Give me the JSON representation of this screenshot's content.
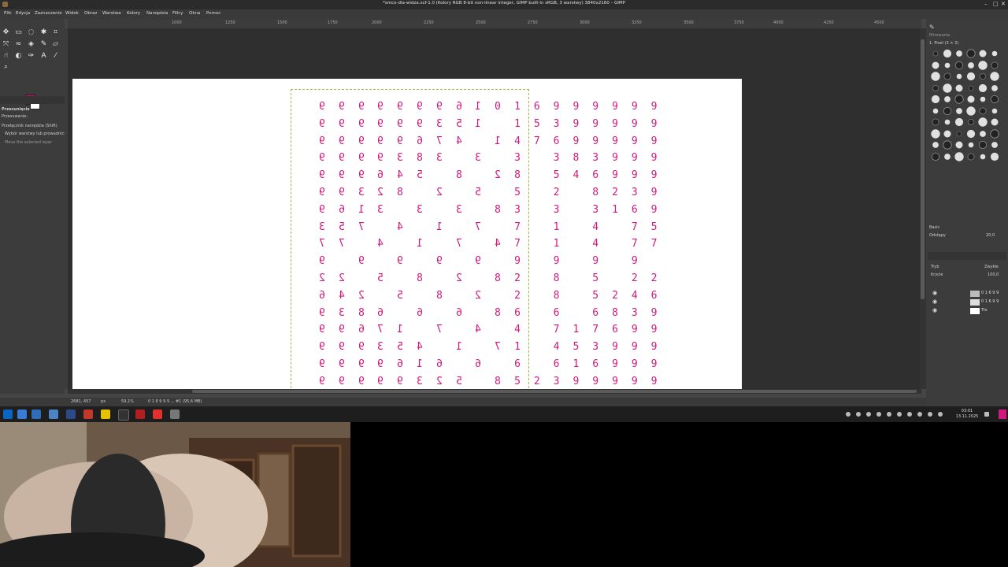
{
  "window": {
    "title": "*smco-dla-widza.xcf-1.0 (Kolory RGB 8-bit non-linear integer, GIMP built-in sRGB, 3 warstwy) 3840x2160 – GIMP",
    "controls": [
      "–",
      "□",
      "✕"
    ]
  },
  "menubar": {
    "items": [
      "Plik",
      "Edycja",
      "Zaznaczenie",
      "Widok",
      "Obraz",
      "Warstwa",
      "Kolory",
      "Narzędzia",
      "Filtry",
      "Okna",
      "Pomoc"
    ]
  },
  "ruler": {
    "ticks": [
      "1000",
      "1250",
      "1500",
      "1750",
      "2000",
      "2250",
      "2500",
      "2750",
      "3000",
      "3250",
      "3500",
      "3750",
      "4000",
      "4250",
      "4500"
    ]
  },
  "toolbox": {
    "tool_icons": [
      "move-tool-icon",
      "rect-select-icon",
      "lasso-icon",
      "fuzzy-select-icon",
      "crop-icon",
      "unified-transform-icon",
      "warp-icon",
      "bucket-fill-icon",
      "paintbrush-icon",
      "eraser-icon",
      "smudge-icon",
      "dodge-icon",
      "path-icon",
      "text-icon",
      "color-picker-icon",
      "zoom-icon"
    ],
    "tool_options_title": "Przesunięcie",
    "option_1": "Przesuwanie:",
    "option_2": "Przełącznik narzędzia (Shift)",
    "option_3": "Wybór warstwy lub prowadnicy",
    "option_4": "Move the selected layer",
    "fg_color": "#e0007a",
    "bg_color": "#ffffff"
  },
  "canvas": {
    "digit_color": "#d0197b",
    "rows": [
      [
        "9",
        "9",
        "9",
        "9",
        "9",
        "9",
        "9",
        "6",
        "1",
        "0",
        "1",
        "6",
        "9",
        "9",
        "9",
        "9",
        "9",
        "9"
      ],
      [
        "9",
        "9",
        "9",
        "9",
        "9",
        "9",
        "3",
        "5",
        "1",
        "",
        "1",
        "5",
        "3",
        "9",
        "9",
        "9",
        "9",
        "9"
      ],
      [
        "9",
        "9",
        "9",
        "9",
        "9",
        "6",
        "7",
        "4",
        "",
        "1",
        "4",
        "7",
        "6",
        "9",
        "9",
        "9",
        "9",
        "9"
      ],
      [
        "9",
        "9",
        "9",
        "9",
        "3",
        "8",
        "3",
        "",
        "3",
        "",
        "3",
        "",
        "3",
        "8",
        "3",
        "9",
        "9",
        "9"
      ],
      [
        "9",
        "9",
        "9",
        "6",
        "4",
        "5",
        "",
        "8",
        "",
        "2",
        "8",
        "",
        "5",
        "4",
        "6",
        "9",
        "9",
        "9"
      ],
      [
        "9",
        "9",
        "3",
        "2",
        "8",
        "",
        "2",
        "",
        "5",
        "",
        "5",
        "",
        "2",
        "",
        "8",
        "2",
        "3",
        "9"
      ],
      [
        "9",
        "6",
        "1",
        "3",
        "",
        "3",
        "",
        "3",
        "",
        "8",
        "3",
        "",
        "3",
        "",
        "3",
        "1",
        "6",
        "9"
      ],
      [
        "3",
        "5",
        "7",
        "",
        "4",
        "",
        "1",
        "",
        "7",
        "",
        "7",
        "",
        "1",
        "",
        "4",
        "",
        "7",
        "5"
      ],
      [
        "7",
        "7",
        "",
        "4",
        "",
        "1",
        "",
        "7",
        "",
        "4",
        "7",
        "",
        "1",
        "",
        "4",
        "",
        "7",
        "7"
      ],
      [
        "9",
        "",
        "9",
        "",
        "9",
        "",
        "9",
        "",
        "9",
        "",
        "9",
        "",
        "9",
        "",
        "9",
        "",
        "9",
        ""
      ],
      [
        "2",
        "2",
        "",
        "5",
        "",
        "8",
        "",
        "2",
        "",
        "8",
        "2",
        "",
        "8",
        "",
        "5",
        "",
        "2",
        "2"
      ],
      [
        "6",
        "4",
        "2",
        "",
        "5",
        "",
        "8",
        "",
        "2",
        "",
        "2",
        "",
        "8",
        "",
        "5",
        "2",
        "4",
        "6"
      ],
      [
        "9",
        "3",
        "8",
        "6",
        "",
        "6",
        "",
        "6",
        "",
        "8",
        "6",
        "",
        "6",
        "",
        "6",
        "8",
        "3",
        "9"
      ],
      [
        "9",
        "9",
        "6",
        "7",
        "1",
        "",
        "7",
        "",
        "4",
        "",
        "4",
        "",
        "7",
        "1",
        "7",
        "6",
        "9",
        "9"
      ],
      [
        "9",
        "9",
        "9",
        "3",
        "5",
        "4",
        "",
        "1",
        "",
        "7",
        "1",
        "",
        "4",
        "5",
        "3",
        "9",
        "9",
        "9"
      ],
      [
        "9",
        "9",
        "9",
        "9",
        "6",
        "1",
        "6",
        "",
        "6",
        "",
        "6",
        "",
        "6",
        "1",
        "6",
        "9",
        "9",
        "9"
      ],
      [
        "9",
        "9",
        "9",
        "9",
        "9",
        "3",
        "2",
        "5",
        "",
        "8",
        "5",
        "2",
        "3",
        "9",
        "9",
        "9",
        "9",
        "9"
      ]
    ]
  },
  "statusbar": {
    "coords": "2681, 457",
    "unit": "px",
    "zoom": "59,1%",
    "info": "0 1 6 9 9 9 ... #1 (95,6 MB)"
  },
  "right_dock": {
    "brush_filter": "filtrowanie",
    "brush_name": "1. Pixel (3 × 3)",
    "preset": "Basic",
    "spacing_label": "Odstępy",
    "spacing_value": "20,0",
    "mode_label": "Tryb",
    "mode_value": "Zwykłe",
    "opacity_label": "Krycie",
    "opacity_value": "100,0",
    "layers": [
      {
        "name": "0 1 6 9 9",
        "visible": true
      },
      {
        "name": "0 1 6 9 9",
        "visible": true
      },
      {
        "name": "Tło",
        "visible": true
      }
    ]
  },
  "taskbar": {
    "time": "03:01",
    "date": "13.11.2025"
  }
}
